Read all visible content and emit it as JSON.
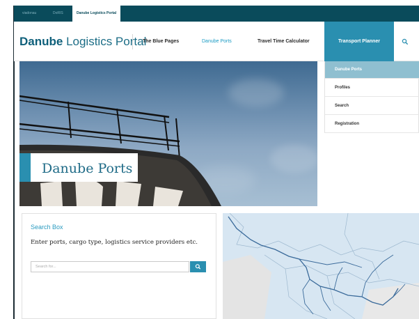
{
  "topbar": {
    "tabs": [
      {
        "label": "viadonau"
      },
      {
        "label": "DoRIS"
      },
      {
        "label": "Danube Logistics Portal"
      }
    ]
  },
  "header": {
    "brand_bold": "Danube",
    "brand_rest": " Logistics Portal",
    "nav": [
      {
        "label": "The Blue Pages"
      },
      {
        "label": "Danube Ports"
      },
      {
        "label": "Travel Time Calculator"
      },
      {
        "label": "Transport Planner"
      }
    ],
    "search_icon": "search-icon"
  },
  "dropdown": {
    "items": [
      {
        "label": "Danube Ports"
      },
      {
        "label": "Profiles"
      },
      {
        "label": "Search"
      },
      {
        "label": "Registration"
      }
    ]
  },
  "hero": {
    "title": "Danube Ports"
  },
  "search_box": {
    "title": "Search Box",
    "description": "Enter ports, cargo type, logistics service providers etc.",
    "placeholder": "Search for...",
    "button_icon": "search-icon"
  },
  "colors": {
    "accent": "#2a8fb0",
    "topbar": "#0a4b5b",
    "brand": "#1c6d86",
    "link": "#1a9bc4",
    "dropdown_active": "#8fbfd0"
  }
}
